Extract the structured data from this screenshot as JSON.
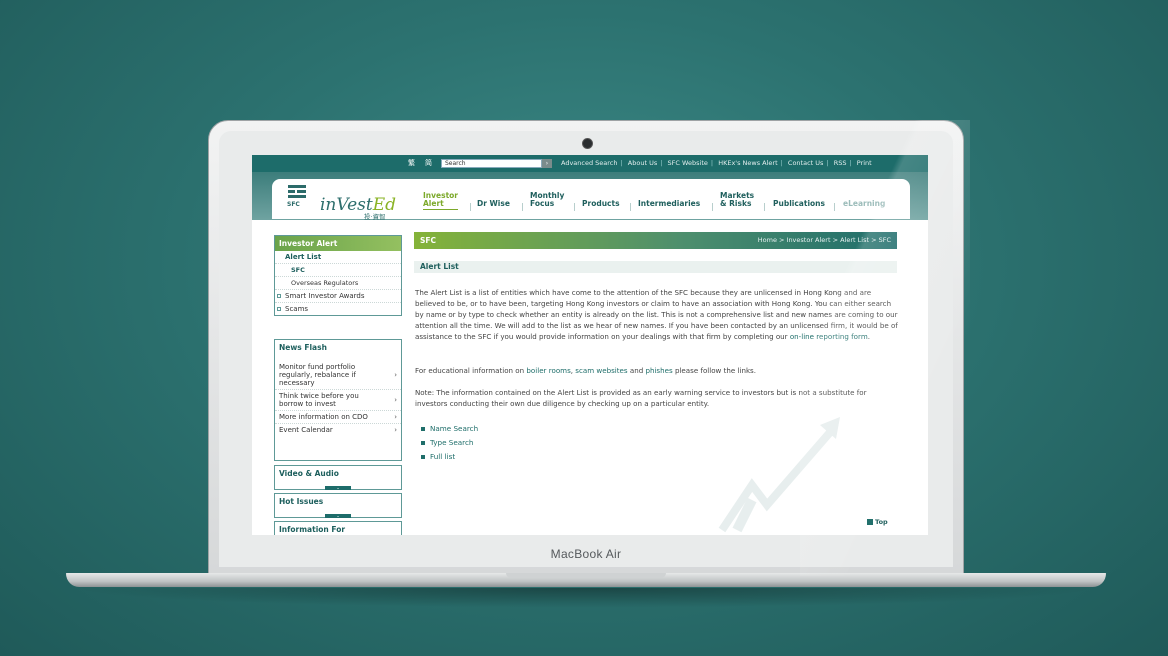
{
  "device": {
    "brand": "MacBook Air"
  },
  "topbar": {
    "lang_tc": "繁",
    "lang_sc": "简",
    "search_value": "Search",
    "search_go": "›",
    "links": [
      "Advanced Search",
      "About Us",
      "SFC Website",
      "HKEx's News Alert",
      "Contact Us",
      "RSS",
      "Print"
    ]
  },
  "header": {
    "sfc_label": "SFC",
    "logo_main": "inVest",
    "logo_ed": "Ed",
    "logo_cn": "投·資智"
  },
  "nav": {
    "investor_alert": [
      "Investor",
      "Alert"
    ],
    "dr_wise": "Dr Wise",
    "monthly_focus": [
      "Monthly",
      "Focus"
    ],
    "products": "Products",
    "intermediaries": "Intermediaries",
    "markets_risks": [
      "Markets",
      "& Risks"
    ],
    "publications": "Publications",
    "elearning": "eLearning"
  },
  "sidebar": {
    "investor_alert": {
      "title": "Investor Alert",
      "items": [
        "Alert List",
        "SFC",
        "Overseas Regulators",
        "Smart Investor Awards",
        "Scams"
      ]
    },
    "news_flash": {
      "title": "News Flash",
      "items": [
        "Monitor fund portfolio regularly, rebalance if necessary",
        "Think twice before you borrow to invest",
        "More information on CDO",
        "Event Calendar"
      ],
      "arrow": "›"
    },
    "video_audio": "Video & Audio",
    "hot_issues": "Hot Issues",
    "information_for": "Information For"
  },
  "main": {
    "crumb_title": "SFC",
    "breadcrumb": "Home > Investor Alert > Alert List > SFC",
    "section_title": "Alert List",
    "para1_a": "The Alert List is a list of entities which have come to the attention of the SFC because they are unlicensed in Hong Kong and are believed to be, or to have been, targeting Hong Kong investors or claim to have an association with Hong Kong. You can either search by name or by type to check whether an entity is already on the list. This is not a comprehensive list and new names are coming to our attention all the time. We will add to the list as we hear of new names. If you have been contacted by an unlicensed firm, it would be of assistance to the SFC if you would provide information on your dealings with that firm by completing our ",
    "para1_link": "on-line reporting form",
    "para1_end": ".",
    "para2_a": "For educational information on ",
    "link_boiler": "boiler rooms",
    "comma": ", ",
    "link_scam": "scam websites",
    "and": " and ",
    "link_phishes": "phishes",
    "para2_end": " please follow the links.",
    "para3": "Note: The information contained on the Alert List is provided as an early warning service to investors but is not a substitute for investors conducting their own due diligence by checking up on a particular entity.",
    "links": [
      "Name Search",
      "Type Search",
      "Full list"
    ],
    "top": "Top"
  }
}
